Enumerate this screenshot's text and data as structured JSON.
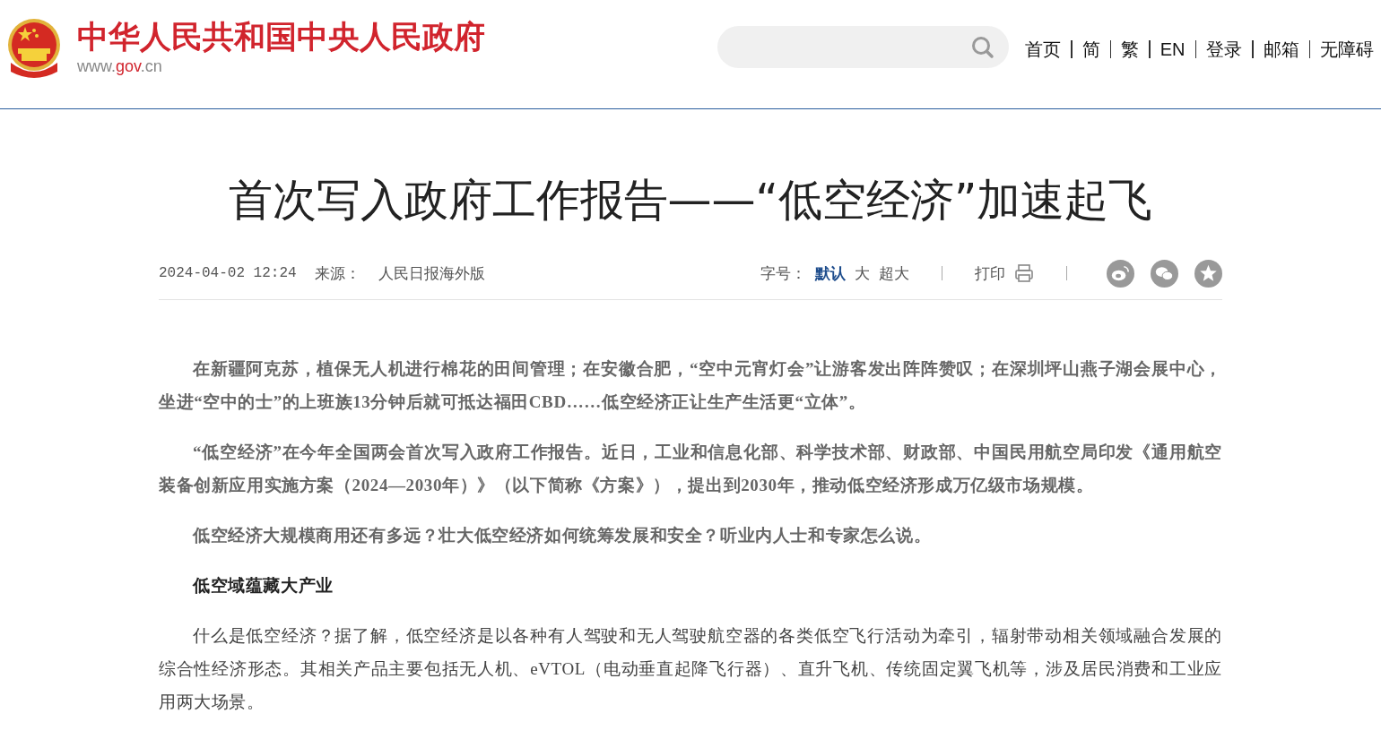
{
  "header": {
    "site_name": "中华人民共和国中央人民政府",
    "site_url": {
      "prefix": "www.",
      "highlight": "gov",
      "suffix": ".cn"
    },
    "nav": [
      "首页",
      "简",
      "繁",
      "EN",
      "登录",
      "邮箱",
      "无障碍"
    ]
  },
  "article": {
    "title": "首次写入政府工作报告——“低空经济”加速起飞",
    "meta": {
      "date": "2024-04-02 12:24",
      "source_label": "来源：",
      "source": "人民日报海外版",
      "font_size_label": "字号：",
      "font_sizes": [
        {
          "label": "默认",
          "selected": true
        },
        {
          "label": "大",
          "selected": false
        },
        {
          "label": "超大",
          "selected": false
        }
      ],
      "print": "打印"
    },
    "paragraphs": [
      {
        "kind": "lead",
        "text": "在新疆阿克苏，植保无人机进行棉花的田间管理；在安徽合肥，“空中元宵灯会”让游客发出阵阵赞叹；在深圳坪山燕子湖会展中心，坐进“空中的士”的上班族13分钟后就可抵达福田CBD……低空经济正让生产生活更“立体”。"
      },
      {
        "kind": "lead",
        "text": "“低空经济”在今年全国两会首次写入政府工作报告。近日，工业和信息化部、科学技术部、财政部、中国民用航空局印发《通用航空装备创新应用实施方案（2024—2030年）》（以下简称《方案》），提出到2030年，推动低空经济形成万亿级市场规模。"
      },
      {
        "kind": "lead",
        "text": "低空经济大规模商用还有多远？壮大低空经济如何统筹发展和安全？听业内人士和专家怎么说。"
      },
      {
        "kind": "heading",
        "text": "低空域蕴藏大产业"
      },
      {
        "kind": "body",
        "text": "什么是低空经济？据了解，低空经济是以各种有人驾驶和无人驾驶航空器的各类低空飞行活动为牵引，辐射带动相关领域融合发展的综合性经济形态。其相关产品主要包括无人机、eVTOL（电动垂直起降飞行器）、直升飞机、传统固定翼飞机等，涉及居民消费和工业应用两大场景。"
      }
    ]
  }
}
